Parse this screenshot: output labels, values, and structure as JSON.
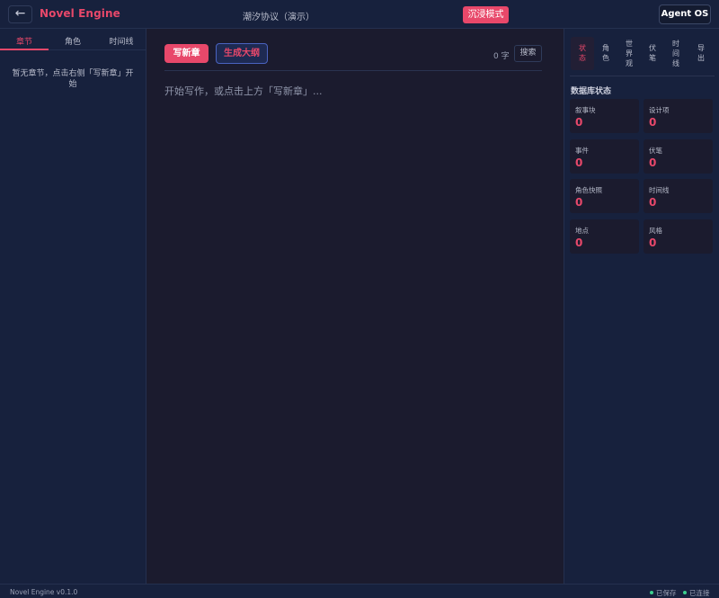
{
  "header": {
    "back_glyph": "←",
    "brand": "Novel Engine",
    "project_title": "潮汐协议（演示）",
    "immersive_label": "沉浸模式",
    "agent_label": "Agent OS"
  },
  "left_sidebar": {
    "tabs": [
      {
        "label": "章节",
        "active": true
      },
      {
        "label": "角色",
        "active": false
      },
      {
        "label": "时间线",
        "active": false
      }
    ],
    "empty_message": "暂无章节，点击右侧「写新章」开始"
  },
  "editor": {
    "write_label": "写新章",
    "outline_label": "生成大纲",
    "word_count": "0 字",
    "search_label": "搜索",
    "placeholder": "开始写作，或点击上方「写新章」..."
  },
  "right_sidebar": {
    "tabs": [
      {
        "label": "状态",
        "active": true
      },
      {
        "label": "角色",
        "active": false
      },
      {
        "label": "世界观",
        "active": false
      },
      {
        "label": "伏笔",
        "active": false
      },
      {
        "label": "时间线",
        "active": false
      },
      {
        "label": "导出",
        "active": false
      }
    ],
    "db_title": "数据库状态",
    "stats": [
      {
        "label": "叙事块",
        "value": "0"
      },
      {
        "label": "设计项",
        "value": "0"
      },
      {
        "label": "事件",
        "value": "0"
      },
      {
        "label": "伏笔",
        "value": "0"
      },
      {
        "label": "角色快照",
        "value": "0"
      },
      {
        "label": "时间线",
        "value": "0"
      },
      {
        "label": "地点",
        "value": "0"
      },
      {
        "label": "风格",
        "value": "0"
      }
    ]
  },
  "statusbar": {
    "version": "Novel Engine v0.1.0",
    "saved": "已保存",
    "connected": "已连接"
  },
  "colors": {
    "accent": "#e8486a",
    "background": "#1b1b2e",
    "panel": "#17213d",
    "status_ok": "#3ccf8e"
  }
}
